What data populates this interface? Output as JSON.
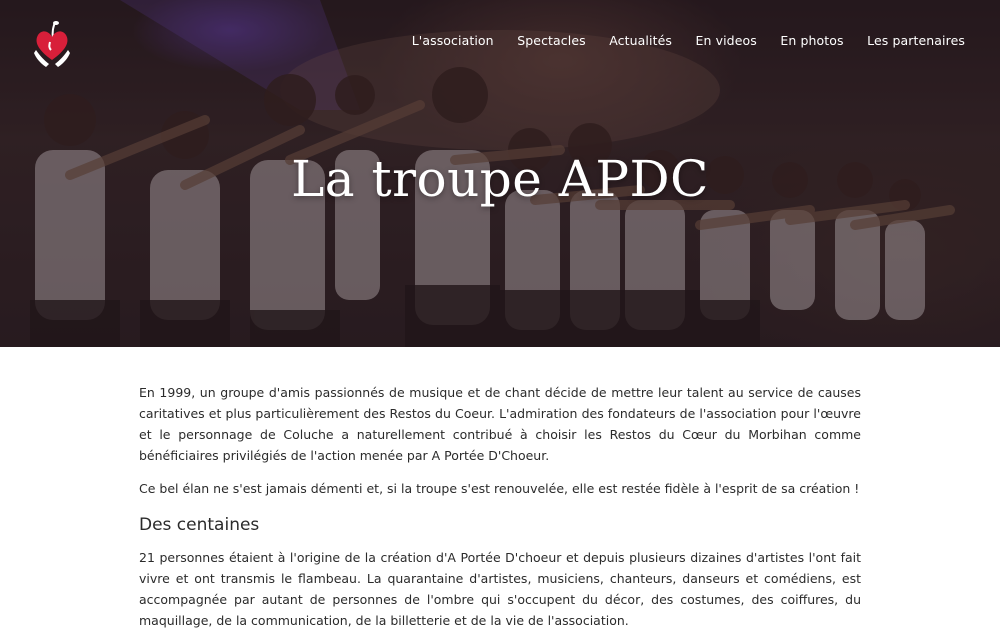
{
  "nav": {
    "items": [
      "L'association",
      "Spectacles",
      "Actualités",
      "En videos",
      "En photos",
      "Les partenaires"
    ]
  },
  "hero": {
    "title": "La troupe APDC"
  },
  "content": {
    "paragraphs": [
      "En 1999, un groupe d'amis passionnés de musique et de chant décide de mettre leur talent au service de causes caritatives et plus particulièrement des Restos du Coeur. L'admiration des fondateurs de l'association pour l'œuvre et le personnage de Coluche a naturellement contribué à choisir les Restos du Cœur du Morbihan comme bénéficiaires privilégiés de l'action menée par A Portée D'Choeur.",
      "Ce bel élan ne s'est jamais démenti et, si la troupe s'est renouvelée, elle est restée fidèle à l'esprit de sa création !"
    ],
    "section_heading": "Des centaines",
    "section_paragraph": "21 personnes étaient à l'origine de la création d'A Portée D'choeur et depuis plusieurs dizaines d'artistes l'ont fait vivre et ont transmis le flambeau. La quarantaine d'artistes, musiciens, chanteurs, danseurs et comédiens, est accompagnée par autant de personnes de l'ombre qui s'occupent du décor, des costumes, des coiffures, du maquillage, de la communication, de la billetterie et de la vie de l'association."
  },
  "colors": {
    "logo_heart": "#d81f3a",
    "text": "#2b2b2b",
    "hero_text": "#ffffff"
  },
  "icons": {
    "logo": "heart-hands-logo-icon"
  }
}
